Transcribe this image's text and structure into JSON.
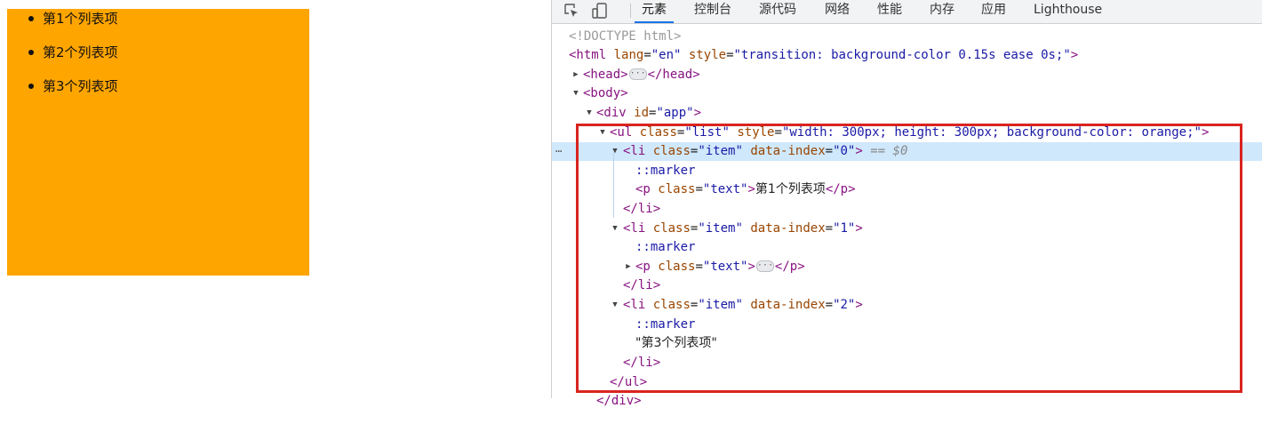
{
  "page": {
    "list_items": [
      "第1个列表项",
      "第2个列表项",
      "第3个列表项"
    ]
  },
  "devtools": {
    "tabs": [
      "元素",
      "控制台",
      "源代码",
      "网络",
      "性能",
      "内存",
      "应用",
      "Lighthouse"
    ],
    "active_tab": "元素",
    "dom": {
      "doctype": "<!DOCTYPE html>",
      "html_open": {
        "tag": "<html",
        "attr1": "lang",
        "val1": "\"en\"",
        "attr2": "style",
        "val2": "\"transition: background-color 0.15s ease 0s;\"",
        "close": ">"
      },
      "head_open": "<head>",
      "head_close": "</head>",
      "body_open": "<body>",
      "div_open": {
        "tag": "<div",
        "attr": "id",
        "val": "\"app\"",
        "close": ">"
      },
      "ul_open": {
        "tag": "<ul",
        "attr1": "class",
        "val1": "\"list\"",
        "attr2": "style",
        "val2": "\"width: 300px; height: 300px; background-color: orange;\"",
        "close": ">"
      },
      "li0_open": {
        "tag": "<li",
        "attr1": "class",
        "val1": "\"item\"",
        "attr2": "data-index",
        "val2": "\"0\"",
        "close": ">",
        "suffix": "== $0"
      },
      "marker": "::marker",
      "p0": {
        "tag": "<p",
        "attr": "class",
        "val": "\"text\"",
        "close": ">",
        "text": "第1个列表项",
        "end": "</p>"
      },
      "li_close": "</li>",
      "li1_open": {
        "tag": "<li",
        "attr1": "class",
        "val1": "\"item\"",
        "attr2": "data-index",
        "val2": "\"1\"",
        "close": ">"
      },
      "p1": {
        "tag": "<p",
        "attr": "class",
        "val": "\"text\"",
        "close": ">",
        "end": "</p>"
      },
      "li2_open": {
        "tag": "<li",
        "attr1": "class",
        "val1": "\"item\"",
        "attr2": "data-index",
        "val2": "\"2\"",
        "close": ">"
      },
      "text_node": "\"第3个列表项\"",
      "ul_close": "</ul>",
      "div_close": "</div>"
    },
    "colors": {
      "highlight_border": "#d9241f",
      "selected_row": "#cfe8fc",
      "page_list_bg": "#ffa500"
    }
  }
}
